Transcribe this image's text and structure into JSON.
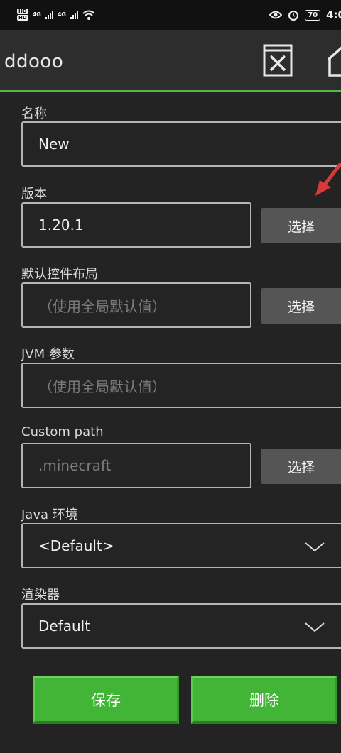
{
  "status_bar": {
    "hd_top": "HD",
    "hd_bottom": "HD",
    "net1": "4G",
    "net2": "4G",
    "battery": "70",
    "time": "4:0"
  },
  "appbar": {
    "title": "ddooo",
    "icons": [
      "delete-icon",
      "home-icon"
    ],
    "accent_color": "#5ab646"
  },
  "form": {
    "name": {
      "label": "名称",
      "value": "New"
    },
    "version": {
      "label": "版本",
      "value": "1.20.1",
      "button": "选择"
    },
    "control_layout": {
      "label": "默认控件布局",
      "placeholder": "（使用全局默认值）",
      "button": "选择"
    },
    "jvm_args": {
      "label": "JVM 参数",
      "placeholder": "（使用全局默认值）"
    },
    "custom_path": {
      "label": "Custom path",
      "placeholder": ".minecraft",
      "button": "选择"
    },
    "java_env": {
      "label": "Java 环境",
      "selected": "<Default>"
    },
    "renderer": {
      "label": "渲染器",
      "selected": "Default"
    }
  },
  "actions": {
    "save": "保存",
    "delete": "删除",
    "button_color": "#43b536"
  },
  "annotation": {
    "icon": "red-arrow-icon",
    "color": "#d83a3a"
  }
}
